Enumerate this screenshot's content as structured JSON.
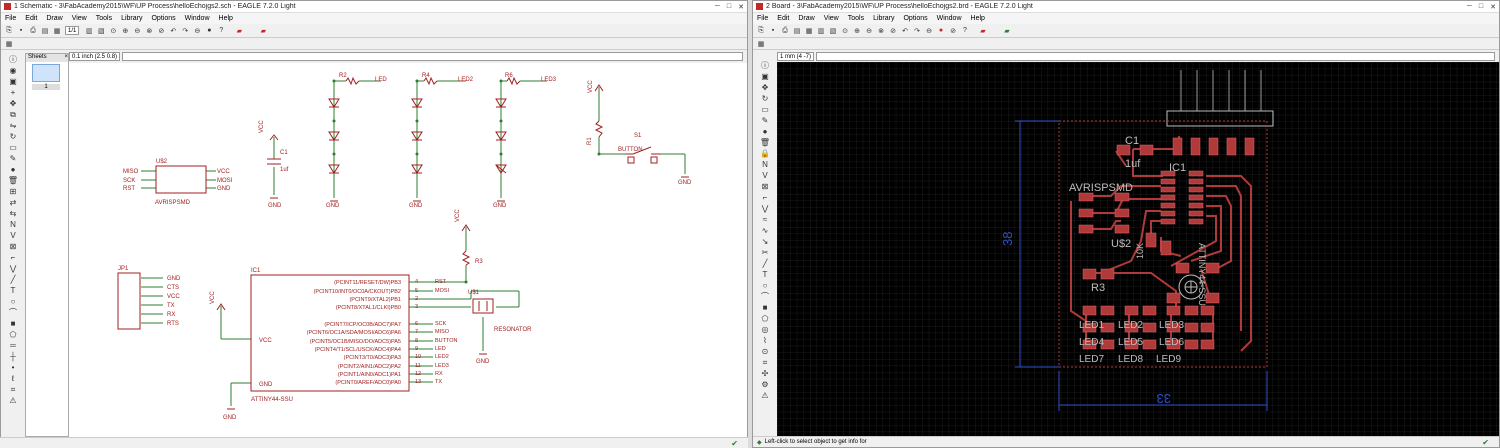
{
  "schematic": {
    "title": "1 Schematic - 3\\FabAcademy2015\\WF\\UP Process\\helloEchojgs2.sch - EAGLE 7.2.0 Light",
    "menu": [
      "File",
      "Edit",
      "Draw",
      "View",
      "Tools",
      "Library",
      "Options",
      "Window",
      "Help"
    ],
    "sheet_select": "1/1",
    "coord": "0.1 inch (2.5 0.8)",
    "sheets_label": "Sheets",
    "sheet_number": "1",
    "labels": {
      "vcc": "VCC",
      "gnd": "GND",
      "c1": "C1",
      "c1v": "1uf",
      "u2": "U$2",
      "avrispsmd": "AVRISPSMD",
      "miso": "MISO",
      "sck": "SCK",
      "rst": "RST",
      "mosi": "MOSI",
      "r2": "R2",
      "r4": "R4",
      "r6": "R6",
      "led": "LED",
      "led2": "LED2",
      "led3": "LED3",
      "s1": "S1",
      "button": "BUTTON",
      "r1": "R1",
      "jp1": "JP1",
      "cts": "CTS",
      "rx": "RX",
      "tx": "TX",
      "rts": "RTS",
      "ic1": "IC1",
      "attiny": "ATTINY44-SSU",
      "u1": "U$1",
      "resonator": "RESONATOR",
      "r3": "R3"
    },
    "ic_pins_right": [
      "(PCINT11/RESET/DW)PB3",
      "(PCINT10/INT0/OC0A/CKOUT)PB2",
      "(PCINT9/XTAL2)PB1",
      "(PCINT8/XTAL1/CLKI)PB0",
      "(PCINT7/ICP/OC0B/ADC7)PA7",
      "(PCINT6/OC1A/SDA/MOSI/ADC6)PA6",
      "(PCINT5/OC1B/MISO/DO/ADC5)PA5",
      "(PCINT4/T1/SCL/USCK/ADC4)PA4",
      "(PCINT3/T0/ADC3)PA3",
      "(PCINT2/AIN1/ADC2)PA2",
      "(PCINT1/AIN0/ADC1)PA1",
      "(PCINT0/AREF/ADC0)PA0"
    ],
    "ic_pin_nums": [
      "4",
      "5",
      "2",
      "3",
      "6",
      "7",
      "8",
      "9",
      "10",
      "11",
      "12",
      "13"
    ],
    "ic_net_labels": [
      "RST",
      "MOSI",
      "",
      "",
      "SCK",
      "MISO",
      "BUTTON",
      "LED",
      "LED2",
      "LED3",
      "RX",
      "TX"
    ]
  },
  "board": {
    "title": "2 Board - 3\\FabAcademy2015\\WF\\UP Process\\helloEchojgs2.brd - EAGLE 7.2.0 Light",
    "menu": [
      "File",
      "Edit",
      "Draw",
      "View",
      "Tools",
      "Library",
      "Options",
      "Window",
      "Help"
    ],
    "coord": "1 mm (4 -7)",
    "status": "Left-click to select object to get info for",
    "labels": {
      "c1": "C1",
      "c1v": "1uf",
      "ic1": "IC1",
      "avrispsmd": "AVRISPSMD",
      "u2": "U$2",
      "attiny": "ATTINY44-SSU",
      "r3": "R3",
      "r10k": "10K",
      "led1": "LED1",
      "led2": "LED2",
      "led3": "LED3",
      "led4": "LED4",
      "led5": "LED5",
      "led6": "LED6",
      "led7": "LED7",
      "led8": "LED8",
      "led9": "LED9",
      "dim_v": "38",
      "dim_h": "33"
    }
  },
  "colors": {
    "board_bg": "#000000",
    "copper": "#b03a3a",
    "grid": "#3a3a3a",
    "dim": "#2f4fc4",
    "schem_wire": "#2e7d32",
    "schem_part": "#a02020"
  }
}
